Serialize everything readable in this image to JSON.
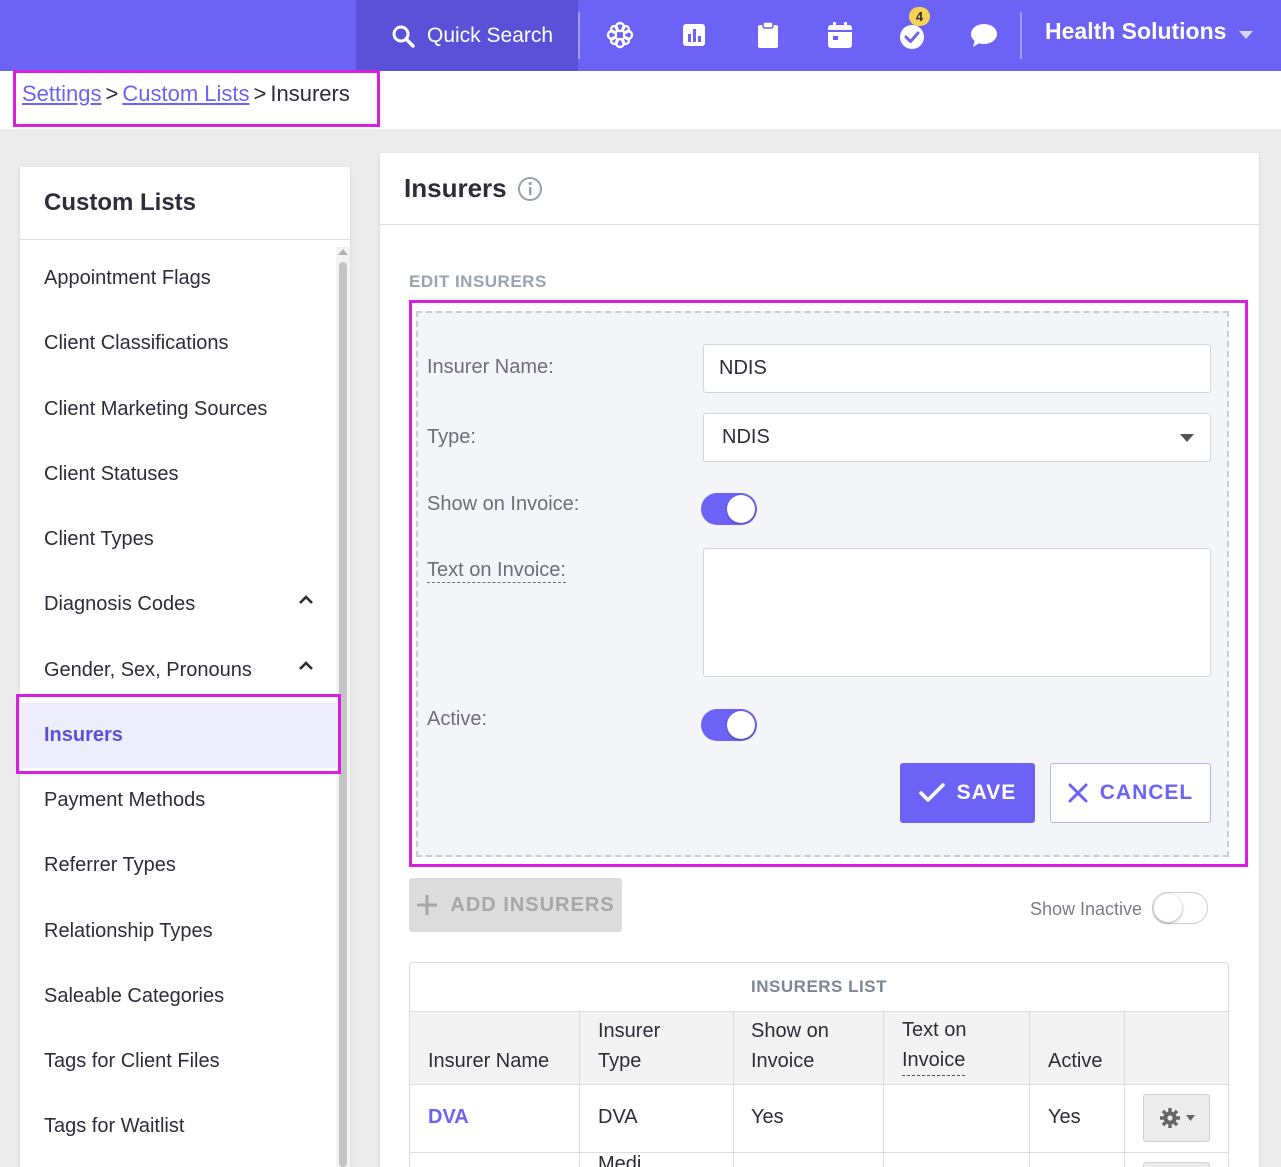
{
  "topbar": {
    "quick_search_label": "Quick Search",
    "notification_count": "4",
    "org_name": "Health Solutions",
    "icons": [
      "search-icon",
      "apps-icon",
      "chart-icon",
      "clipboard-icon",
      "calendar-icon",
      "tasks-check-icon",
      "chat-icon",
      "chevron-down-icon"
    ]
  },
  "breadcrumb": {
    "settings": "Settings",
    "custom_lists": "Custom Lists",
    "current": "Insurers",
    "separator": ">"
  },
  "sidebar": {
    "title": "Custom Lists",
    "items": [
      {
        "label": "Appointment Flags"
      },
      {
        "label": "Client Classifications"
      },
      {
        "label": "Client Marketing Sources"
      },
      {
        "label": "Client Statuses"
      },
      {
        "label": "Client Types"
      },
      {
        "label": "Diagnosis Codes",
        "expanded": true
      },
      {
        "label": "Gender, Sex, Pronouns",
        "expanded": true
      },
      {
        "label": "Insurers",
        "active": true
      },
      {
        "label": "Payment Methods"
      },
      {
        "label": "Referrer Types"
      },
      {
        "label": "Relationship Types"
      },
      {
        "label": "Saleable Categories"
      },
      {
        "label": "Tags for Client Files"
      },
      {
        "label": "Tags for Waitlist"
      }
    ]
  },
  "main": {
    "title": "Insurers",
    "section_label": "EDIT INSURERS",
    "form": {
      "insurer_name_label": "Insurer Name:",
      "insurer_name_value": "NDIS",
      "type_label": "Type:",
      "type_value": "NDIS",
      "show_on_invoice_label": "Show on Invoice:",
      "show_on_invoice": true,
      "text_on_invoice_label": "Text on Invoice:",
      "text_on_invoice_value": "",
      "active_label": "Active:",
      "active": true,
      "save_label": "SAVE",
      "cancel_label": "CANCEL"
    },
    "add_button_label": "ADD INSURERS",
    "show_inactive_label": "Show Inactive",
    "show_inactive": false,
    "table": {
      "title": "INSURERS LIST",
      "columns": [
        "Insurer Name",
        "Insurer Type",
        "Show on Invoice",
        "Text on Invoice",
        "Active"
      ],
      "column_lines": [
        [
          "Insurer Name"
        ],
        [
          "Insurer",
          "Type"
        ],
        [
          "Show on",
          "Invoice"
        ],
        [
          "Text on",
          "Invoice"
        ],
        [
          "Active"
        ]
      ],
      "rows": [
        {
          "name": "DVA",
          "type": "DVA",
          "show_on_invoice": "Yes",
          "text_on_invoice": "",
          "active": "Yes"
        }
      ],
      "partial_next_row_type": "Medi..."
    }
  },
  "colors": {
    "accent": "#6c63f6",
    "highlight": "#d81fe0",
    "badge": "#f6d257"
  }
}
